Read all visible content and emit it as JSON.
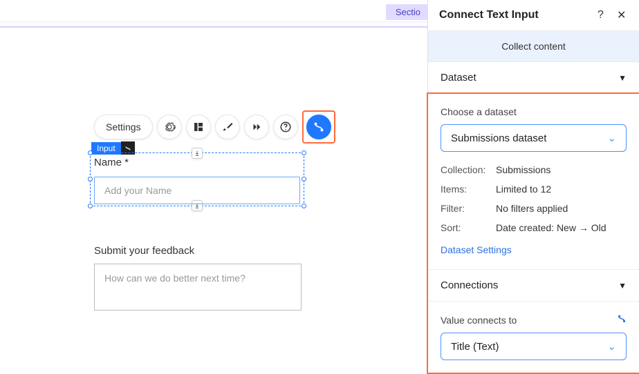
{
  "canvas": {
    "section_pill": "Sectio",
    "toolbar": {
      "settings": "Settings"
    },
    "input_tag": "Input",
    "name_label": "Name *",
    "name_placeholder": "Add your Name",
    "feedback_label": "Submit your feedback",
    "feedback_placeholder": "How can we do better next time?"
  },
  "panel": {
    "title": "Connect Text Input",
    "collect": "Collect content",
    "dataset": {
      "heading": "Dataset",
      "choose_label": "Choose a dataset",
      "selected": "Submissions dataset",
      "collection_key": "Collection:",
      "collection_val": "Submissions",
      "items_key": "Items:",
      "items_val": "Limited to 12",
      "filter_key": "Filter:",
      "filter_val": "No filters applied",
      "sort_key": "Sort:",
      "sort_val": "Date created: New → Old",
      "settings_link": "Dataset Settings"
    },
    "connections": {
      "heading": "Connections",
      "value_label": "Value connects to",
      "selected": "Title (Text)"
    }
  }
}
